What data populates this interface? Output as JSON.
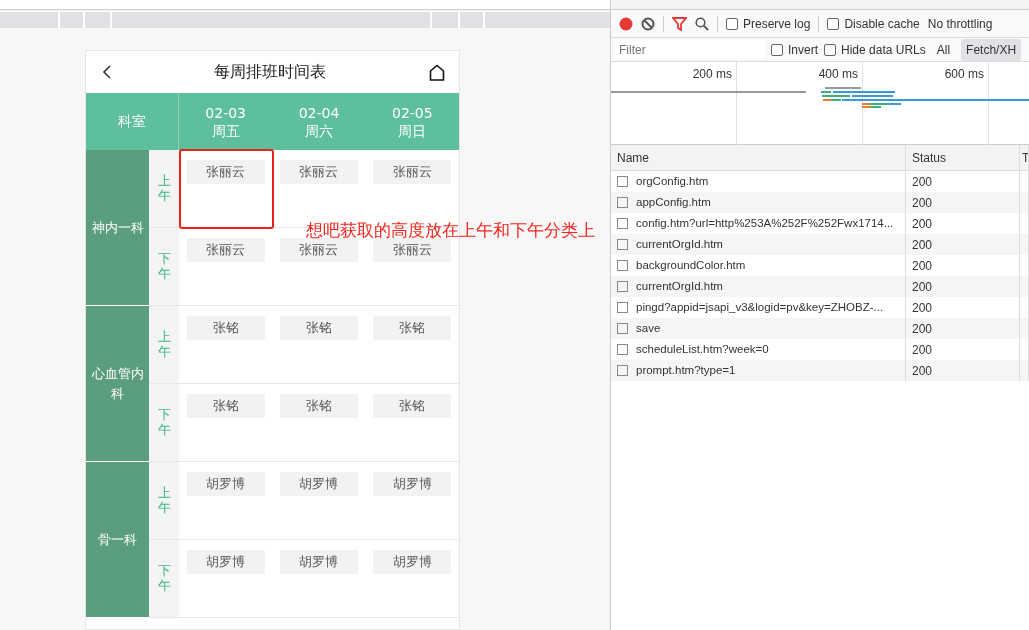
{
  "phone": {
    "title": "每周排班时间表",
    "corner_label": "科室",
    "days": [
      {
        "date": "02-03",
        "weekday": "周五"
      },
      {
        "date": "02-04",
        "weekday": "周六"
      },
      {
        "date": "02-05",
        "weekday": "周日"
      }
    ],
    "departments": [
      {
        "name": "神内一科",
        "periods": [
          {
            "label": "上午",
            "doctors": [
              "张丽云",
              "张丽云",
              "张丽云"
            ]
          },
          {
            "label": "下午",
            "doctors": [
              "张丽云",
              "张丽云",
              "张丽云"
            ]
          }
        ]
      },
      {
        "name": "心血管内科",
        "periods": [
          {
            "label": "上午",
            "doctors": [
              "张铭",
              "张铭",
              "张铭"
            ]
          },
          {
            "label": "下午",
            "doctors": [
              "张铭",
              "张铭",
              "张铭"
            ]
          }
        ]
      },
      {
        "name": "骨一科",
        "periods": [
          {
            "label": "上午",
            "doctors": [
              "胡罗博",
              "胡罗博",
              "胡罗博"
            ]
          },
          {
            "label": "下午",
            "doctors": [
              "胡罗博",
              "胡罗博",
              "胡罗博"
            ]
          }
        ]
      }
    ]
  },
  "devtools": {
    "toolbar": {
      "recording": true,
      "preserve_log": {
        "label": "Preserve log",
        "checked": false
      },
      "disable_cache": {
        "label": "Disable cache",
        "checked": false
      },
      "throttling": "No throttling"
    },
    "filter": {
      "placeholder": "Filter",
      "invert": {
        "label": "Invert",
        "checked": false
      },
      "hide_data_urls": {
        "label": "Hide data URLs",
        "checked": false
      },
      "types": [
        {
          "label": "All",
          "selected": false
        },
        {
          "label": "Fetch/XH",
          "selected": true
        }
      ]
    },
    "timeline_ticks": [
      "200 ms",
      "400 ms",
      "600 ms"
    ],
    "columns": [
      "Name",
      "Status",
      "T"
    ],
    "requests": [
      {
        "name": "orgConfig.htm",
        "status": "200",
        "checked": false
      },
      {
        "name": "appConfig.htm",
        "status": "200",
        "checked": false
      },
      {
        "name": "config.htm?url=http%253A%252F%252Fwx1714...",
        "status": "200",
        "checked": false
      },
      {
        "name": "currentOrgId.htm",
        "status": "200",
        "checked": false
      },
      {
        "name": "backgroundColor.htm",
        "status": "200",
        "checked": false
      },
      {
        "name": "currentOrgId.htm",
        "status": "200",
        "checked": false
      },
      {
        "name": "pingd?appid=jsapi_v3&logid=pv&key=ZHOBZ-...",
        "status": "200",
        "checked": false
      },
      {
        "name": "save",
        "status": "200",
        "checked": false
      },
      {
        "name": "scheduleList.htm?week=0",
        "status": "200",
        "checked": false
      },
      {
        "name": "prompt.htm?type=1",
        "status": "200",
        "checked": false
      }
    ]
  },
  "annotation": {
    "text": "想吧获取的高度放在上午和下午分类上"
  }
}
